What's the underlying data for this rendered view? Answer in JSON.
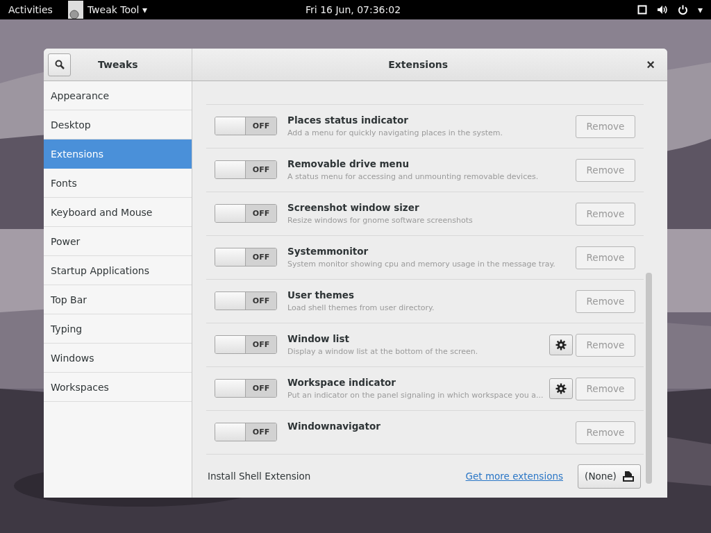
{
  "top_bar": {
    "activities": "Activities",
    "app_menu": "Tweak Tool",
    "app_menu_caret": "▾",
    "clock": "Fri 16 Jun, 07:36:02",
    "system_caret": "▾"
  },
  "window": {
    "search_selected": false,
    "sidebar_title": "Tweaks",
    "title": "Extensions",
    "close": "×"
  },
  "sidebar": {
    "items": [
      {
        "label": "Appearance",
        "selected": false
      },
      {
        "label": "Desktop",
        "selected": false
      },
      {
        "label": "Extensions",
        "selected": true
      },
      {
        "label": "Fonts",
        "selected": false
      },
      {
        "label": "Keyboard and Mouse",
        "selected": false
      },
      {
        "label": "Power",
        "selected": false
      },
      {
        "label": "Startup Applications",
        "selected": false
      },
      {
        "label": "Top Bar",
        "selected": false
      },
      {
        "label": "Typing",
        "selected": false
      },
      {
        "label": "Windows",
        "selected": false
      },
      {
        "label": "Workspaces",
        "selected": false
      }
    ]
  },
  "extensions": [
    {
      "name": "Places status indicator",
      "description": "Add a menu for quickly navigating places in the system.",
      "on": false,
      "switch_label": "OFF",
      "settings": false,
      "remove": "Remove"
    },
    {
      "name": "Removable drive menu",
      "description": "A status menu for accessing and unmounting removable devices.",
      "on": false,
      "switch_label": "OFF",
      "settings": false,
      "remove": "Remove"
    },
    {
      "name": "Screenshot window sizer",
      "description": "Resize windows for gnome software screenshots",
      "on": false,
      "switch_label": "OFF",
      "settings": false,
      "remove": "Remove"
    },
    {
      "name": "Systemmonitor",
      "description": "System monitor showing cpu and memory usage in the message tray.",
      "on": false,
      "switch_label": "OFF",
      "settings": false,
      "remove": "Remove"
    },
    {
      "name": "User themes",
      "description": "Load shell themes from user directory.",
      "on": false,
      "switch_label": "OFF",
      "settings": false,
      "remove": "Remove"
    },
    {
      "name": "Window list",
      "description": "Display a window list at the bottom of the screen.",
      "on": false,
      "switch_label": "OFF",
      "settings": true,
      "remove": "Remove"
    },
    {
      "name": "Workspace indicator",
      "description": "Put an indicator on the panel signaling in which workspace you a...",
      "on": false,
      "switch_label": "OFF",
      "settings": true,
      "remove": "Remove"
    },
    {
      "name": "Windownavigator",
      "on": false,
      "switch_label": "OFF",
      "settings": false,
      "remove": "Remove"
    }
  ],
  "install": {
    "label": "Install Shell Extension",
    "link": "Get more extensions",
    "file_button": "(None)"
  }
}
